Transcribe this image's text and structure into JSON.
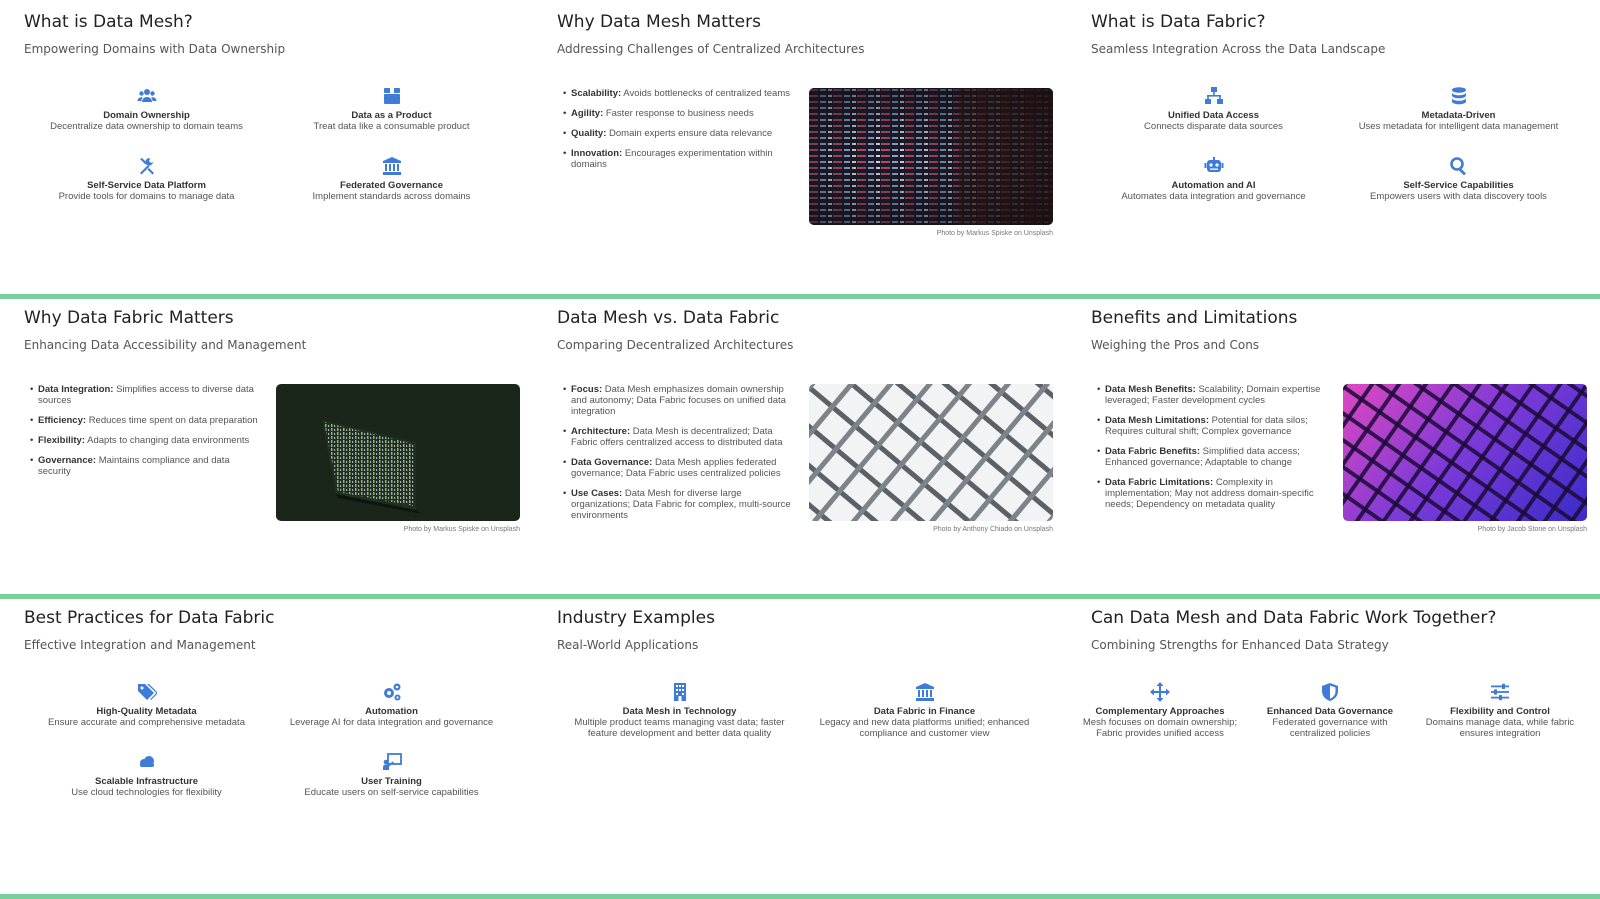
{
  "colors": {
    "accent": "#3f7bd8",
    "separator": "#7bcf9c"
  },
  "slides": [
    {
      "title": "What is Data Mesh?",
      "subtitle": "Empowering Domains with Data Ownership",
      "features": [
        {
          "icon": "users-icon",
          "title": "Domain Ownership",
          "desc": "Decentralize data ownership to domain teams"
        },
        {
          "icon": "box-icon",
          "title": "Data as a Product",
          "desc": "Treat data like a consumable product"
        },
        {
          "icon": "tools-icon",
          "title": "Self-Service Data Platform",
          "desc": "Provide tools for domains to manage data"
        },
        {
          "icon": "landmark-icon",
          "title": "Federated Governance",
          "desc": "Implement standards across domains"
        }
      ]
    },
    {
      "title": "Why Data Mesh Matters",
      "subtitle": "Addressing Challenges of Centralized Architectures",
      "bullets": [
        {
          "label": "Scalability:",
          "text": "Avoids bottlenecks of centralized teams"
        },
        {
          "label": "Agility:",
          "text": "Faster response to business needs"
        },
        {
          "label": "Quality:",
          "text": "Domain experts ensure data relevance"
        },
        {
          "label": "Innovation:",
          "text": "Encourages experimentation within domains"
        }
      ],
      "photo_credit": "Photo by Markus Spiske on Unsplash"
    },
    {
      "title": "What is Data Fabric?",
      "subtitle": "Seamless Integration Across the Data Landscape",
      "features": [
        {
          "icon": "network-icon",
          "title": "Unified Data Access",
          "desc": "Connects disparate data sources"
        },
        {
          "icon": "database-icon",
          "title": "Metadata-Driven",
          "desc": "Uses metadata for intelligent data management"
        },
        {
          "icon": "robot-icon",
          "title": "Automation and AI",
          "desc": "Automates data integration and governance"
        },
        {
          "icon": "search-icon",
          "title": "Self-Service Capabilities",
          "desc": "Empowers users with data discovery tools"
        }
      ]
    },
    {
      "title": "Why Data Fabric Matters",
      "subtitle": "Enhancing Data Accessibility and Management",
      "bullets": [
        {
          "label": "Data Integration:",
          "text": "Simplifies access to diverse data sources"
        },
        {
          "label": "Efficiency:",
          "text": "Reduces time spent on data preparation"
        },
        {
          "label": "Flexibility:",
          "text": "Adapts to changing data environments"
        },
        {
          "label": "Governance:",
          "text": "Maintains compliance and data security"
        }
      ],
      "photo_credit": "Photo by Markus Spiske on Unsplash"
    },
    {
      "title": "Data Mesh vs. Data Fabric",
      "subtitle": "Comparing Decentralized Architectures",
      "bullets": [
        {
          "label": "Focus:",
          "text": "Data Mesh emphasizes domain ownership and autonomy; Data Fabric focuses on unified data integration"
        },
        {
          "label": "Architecture:",
          "text": "Data Mesh is decentralized; Data Fabric offers centralized access to distributed data"
        },
        {
          "label": "Data Governance:",
          "text": "Data Mesh applies federated governance; Data Fabric uses centralized policies"
        },
        {
          "label": "Use Cases:",
          "text": "Data Mesh for diverse large organizations; Data Fabric for complex, multi-source environments"
        }
      ],
      "photo_credit": "Photo by Anthony Chiado on Unsplash"
    },
    {
      "title": "Benefits and Limitations",
      "subtitle": "Weighing the Pros and Cons",
      "bullets": [
        {
          "label": "Data Mesh Benefits:",
          "text": "Scalability; Domain expertise leveraged; Faster development cycles"
        },
        {
          "label": "Data Mesh Limitations:",
          "text": "Potential for data silos; Requires cultural shift; Complex governance"
        },
        {
          "label": "Data Fabric Benefits:",
          "text": "Simplified data access; Enhanced governance; Adaptable to change"
        },
        {
          "label": "Data Fabric Limitations:",
          "text": "Complexity in implementation; May not address domain-specific needs; Dependency on metadata quality"
        }
      ],
      "photo_credit": "Photo by Jacob Stone on Unsplash"
    },
    {
      "title": "Best Practices for Data Fabric",
      "subtitle": "Effective Integration and Management",
      "features": [
        {
          "icon": "tags-icon",
          "title": "High-Quality Metadata",
          "desc": "Ensure accurate and comprehensive metadata"
        },
        {
          "icon": "cogs-icon",
          "title": "Automation",
          "desc": "Leverage AI for data integration and governance"
        },
        {
          "icon": "cloud-icon",
          "title": "Scalable Infrastructure",
          "desc": "Use cloud technologies for flexibility"
        },
        {
          "icon": "teacher-icon",
          "title": "User Training",
          "desc": "Educate users on self-service capabilities"
        }
      ]
    },
    {
      "title": "Industry Examples",
      "subtitle": "Real-World Applications",
      "features": [
        {
          "icon": "building-icon",
          "title": "Data Mesh in Technology",
          "desc": "Multiple product teams managing vast data; faster feature development and better data quality"
        },
        {
          "icon": "landmark-icon",
          "title": "Data Fabric in Finance",
          "desc": "Legacy and new data platforms unified; enhanced compliance and customer view"
        }
      ]
    },
    {
      "title": "Can Data Mesh and Data Fabric Work Together?",
      "subtitle": "Combining Strengths for Enhanced Data Strategy",
      "features": [
        {
          "icon": "arrows-icon",
          "title": "Complementary Approaches",
          "desc": "Mesh focuses on domain ownership; Fabric provides unified access"
        },
        {
          "icon": "shield-icon",
          "title": "Enhanced Data Governance",
          "desc": "Federated governance with centralized policies"
        },
        {
          "icon": "sliders-icon",
          "title": "Flexibility and Control",
          "desc": "Domains manage data, while fabric ensures integration"
        }
      ]
    }
  ]
}
